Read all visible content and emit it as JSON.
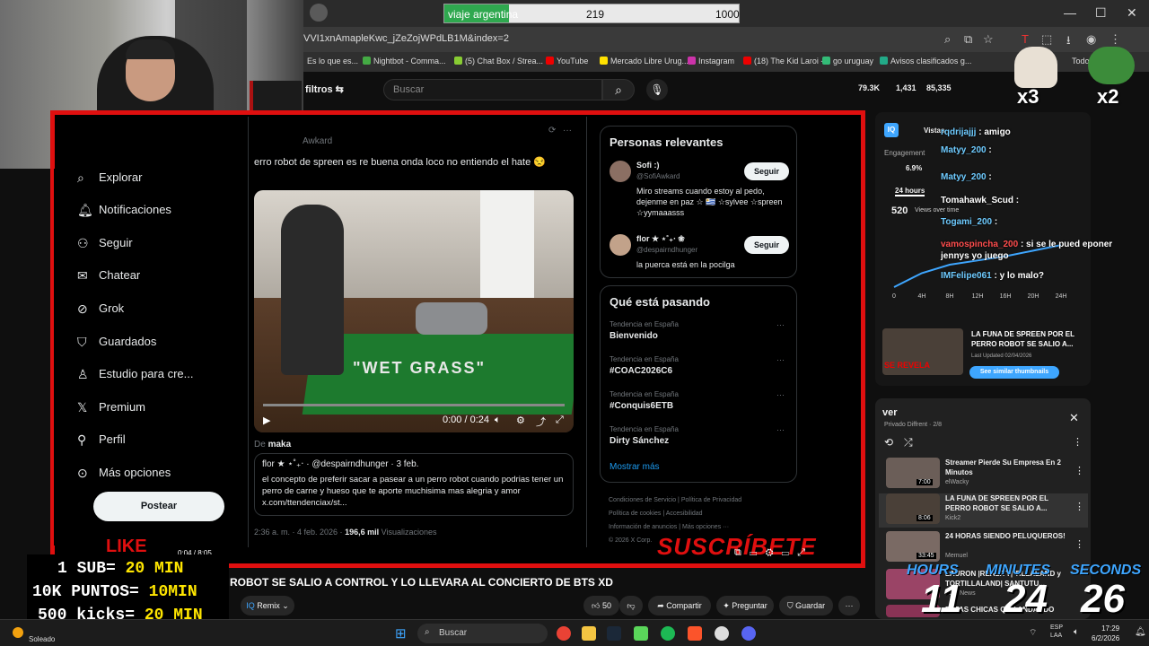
{
  "goal": {
    "label": "viaje argentina",
    "current": "219",
    "max": "1000",
    "progress_fraction": 0.219
  },
  "browser": {
    "url": "VVI1xnAmapleKwc_jZeZojWPdLB1M&index=2",
    "bookmarks": [
      "Es lo que es...",
      "Nightbot - Comma...",
      "(5) Chat Box / Strea...",
      "YouTube",
      "Mercado Libre Urug...",
      "Instagram",
      "(18) The Kid Laroi -...",
      "go uruguay",
      "Avisos clasificados g...",
      "Todos"
    ]
  },
  "youtube": {
    "filters_label": "filtros",
    "search_placeholder": "Buscar",
    "stats": [
      "79.3K",
      "1,431",
      "85,335"
    ]
  },
  "x_sidebar": {
    "items": [
      "Explorar",
      "Notificaciones",
      "Seguir",
      "Chatear",
      "Grok",
      "Guardados",
      "Estudio para cre...",
      "Premium",
      "Perfil",
      "Más opciones"
    ],
    "icons": [
      "search-icon",
      "bell-icon",
      "follow-icon",
      "mail-icon",
      "grok-icon",
      "bookmark-icon",
      "studio-icon",
      "x-logo-icon",
      "profile-icon",
      "more-icon"
    ],
    "post_label": "Postear"
  },
  "tweet": {
    "user": "Awkard",
    "text": "erro robot de spreen es re buena onda loco no entiendo el hate 😒",
    "video_time": "0:00 / 0:24",
    "video_progress": 0.0,
    "rug_text": "\"WET GRASS\"",
    "from_label": "De",
    "from_user": "maka",
    "quote_user": "flor ★ ⋆˚₊‧ · @despairndhunger · 3 feb.",
    "quote_text": "el concepto de preferir sacar a pasear a un perro robot cuando podrias tener un perro de carne y hueso que te aporte muchisima mas alegria y amor x.com/ttendenciax/st...",
    "meta_time": "2:36 a. m. · 4 feb. 2026 ·",
    "meta_views": "196,6 mil",
    "meta_views_label": "Visualizaciones"
  },
  "relevant": {
    "title": "Personas relevantes",
    "people": [
      {
        "name": "Sofi :)",
        "handle": "@SofiAwkard",
        "bio": "Miro streams cuando estoy al pedo, dejenme en paz ☆ 🇺🇾 ☆sylvee ☆spreen ☆yymaaasss",
        "follow": "Seguir"
      },
      {
        "name": "flor ★ ⋆˚₊‧ ❀",
        "handle": "@despairndhunger",
        "bio": "la puerca está en la pocilga",
        "follow": "Seguir"
      }
    ]
  },
  "trends": {
    "title": "Qué está pasando",
    "items": [
      {
        "cat": "Tendencia en España",
        "name": "Bienvenido"
      },
      {
        "cat": "Tendencia en España",
        "name": "#COAC2026C6"
      },
      {
        "cat": "Tendencia en España",
        "name": "#Conquis6ETB"
      },
      {
        "cat": "Tendencia en España",
        "name": "Dirty Sánchez"
      }
    ],
    "more": "Mostrar más",
    "footer": [
      "Condiciones de Servicio",
      "Política de Privacidad",
      "Política de cookies",
      "Accesibilidad",
      "Información de anuncios",
      "Más opciones ···",
      "© 2026 X Corp."
    ]
  },
  "overlay": {
    "suscribete": "SUSCRÍBETE",
    "like": "LIKE",
    "player_time": "0:04 / 8:05",
    "rewards": [
      {
        "left": "1 SUB=",
        "right": "20 MIN"
      },
      {
        "left": "10K PUNTOS=",
        "right": "10MIN"
      },
      {
        "left": "500 kicks=",
        "right": "20 MIN"
      }
    ],
    "meme_x3": "x3",
    "meme_x2": "x2"
  },
  "video": {
    "title": "ROBOT SE SALIO A CONTROL Y LO LLEVARA AL CONCIERTO DE BTS XD",
    "remix": "Remix",
    "likes": "50",
    "share": "Compartir",
    "ask": "Preguntar",
    "save": "Guardar"
  },
  "chat": [
    {
      "user": "rqdrijajjj",
      "msg": ": amigo",
      "color": "u"
    },
    {
      "user": "Matyy_200",
      "msg": ":",
      "color": "u"
    },
    {
      "user": "Matyy_200",
      "msg": ":",
      "color": "u"
    },
    {
      "user": "Tomahawk_Scud",
      "msg": ":",
      "color": "w"
    },
    {
      "user": "Togami_200",
      "msg": ":",
      "color": "u"
    },
    {
      "user": "vamospincha_200",
      "msg": ": si se le pued eponer jennys yo juego",
      "color": "r"
    },
    {
      "user": "IMFelipe061",
      "msg": ": y lo malo?",
      "color": "u"
    }
  ],
  "analytics": {
    "tab": "Vistas",
    "engagement_label": "Engagement",
    "engagement": "6.9%",
    "range": "24 hours",
    "views": "520",
    "views_label": "Views over time",
    "x_ticks": [
      "0",
      "4H",
      "8H",
      "12H",
      "16H",
      "20H",
      "24H"
    ],
    "series": [
      0,
      50,
      80,
      95,
      110,
      130,
      150
    ],
    "thumb_title": "LA FUNA DE SPREEN POR EL PERRO ROBOT SE SALIO A...",
    "last_updated": "Last Updated 02/04/2026",
    "similar_btn": "See similar thumbnails",
    "thumb_text": "SE REVELA"
  },
  "playlist": {
    "title": "ver",
    "sub": "Privado  Diffrent · 2/8",
    "items": [
      {
        "name": "Streamer Pierde Su Empresa En 2 Minutos",
        "chan": "elWacky",
        "dur": "7:00"
      },
      {
        "name": "LA FUNA DE SPREEN POR EL PERRO ROBOT SE SALIO A...",
        "chan": "Kick2",
        "dur": "8:06"
      },
      {
        "name": "24 HORAS SIENDO PELUQUEROS!",
        "chan": "Memuel",
        "dur": "33:45"
      },
      {
        "name": "LAURON |REALITY| TILLALAND y TORTILLALAND| SANTUTU...",
        "chan": "Your News",
        "dur": ""
      },
      {
        "name": "ESTAS CHICAS QUE ANDANDO",
        "chan": "",
        "dur": ""
      }
    ]
  },
  "counter": {
    "hours_label": "HOURS",
    "minutes_label": "MINUTES",
    "seconds_label": "SECONDS",
    "hours": "11",
    "minutes": "24",
    "seconds": "26"
  },
  "taskbar": {
    "weather": "Soleado",
    "search": "Buscar",
    "lang1": "ESP",
    "lang2": "LAA",
    "time": "17:29",
    "date": "6/2/2026"
  }
}
